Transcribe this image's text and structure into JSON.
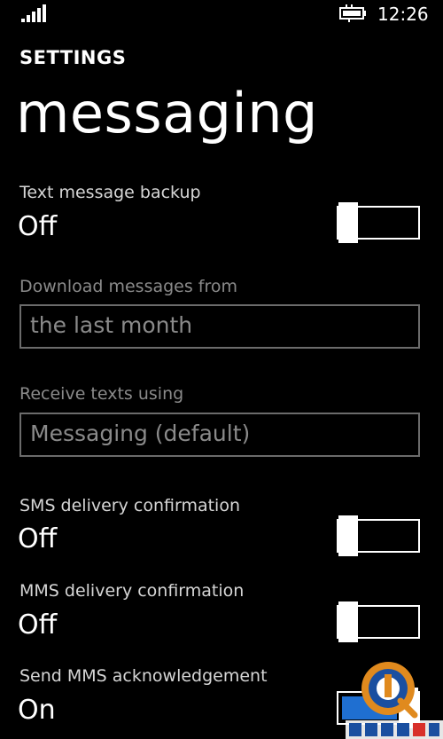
{
  "status_bar": {
    "time": "12:26",
    "signal_icon": "signal-strength-icon",
    "battery_icon": "battery-charging-icon"
  },
  "header": {
    "app_title": "SETTINGS",
    "page_title": "messaging"
  },
  "settings": {
    "text_backup": {
      "label": "Text message backup",
      "value": "Off",
      "state": false
    },
    "download_from": {
      "label": "Download messages from",
      "value": "the last month",
      "enabled": false
    },
    "receive_using": {
      "label": "Receive texts using",
      "value": "Messaging (default)",
      "enabled": false
    },
    "sms_confirm": {
      "label": "SMS delivery confirmation",
      "value": "Off",
      "state": false
    },
    "mms_confirm": {
      "label": "MMS delivery confirmation",
      "value": "Off",
      "state": false
    },
    "mms_ack": {
      "label": "Send MMS acknowledgement",
      "value": "On",
      "state": true
    }
  },
  "colors": {
    "background": "#000000",
    "accent": "#1f6fd1",
    "disabled_text": "#8a8a8a"
  },
  "watermark_logo": "watermark-logo"
}
